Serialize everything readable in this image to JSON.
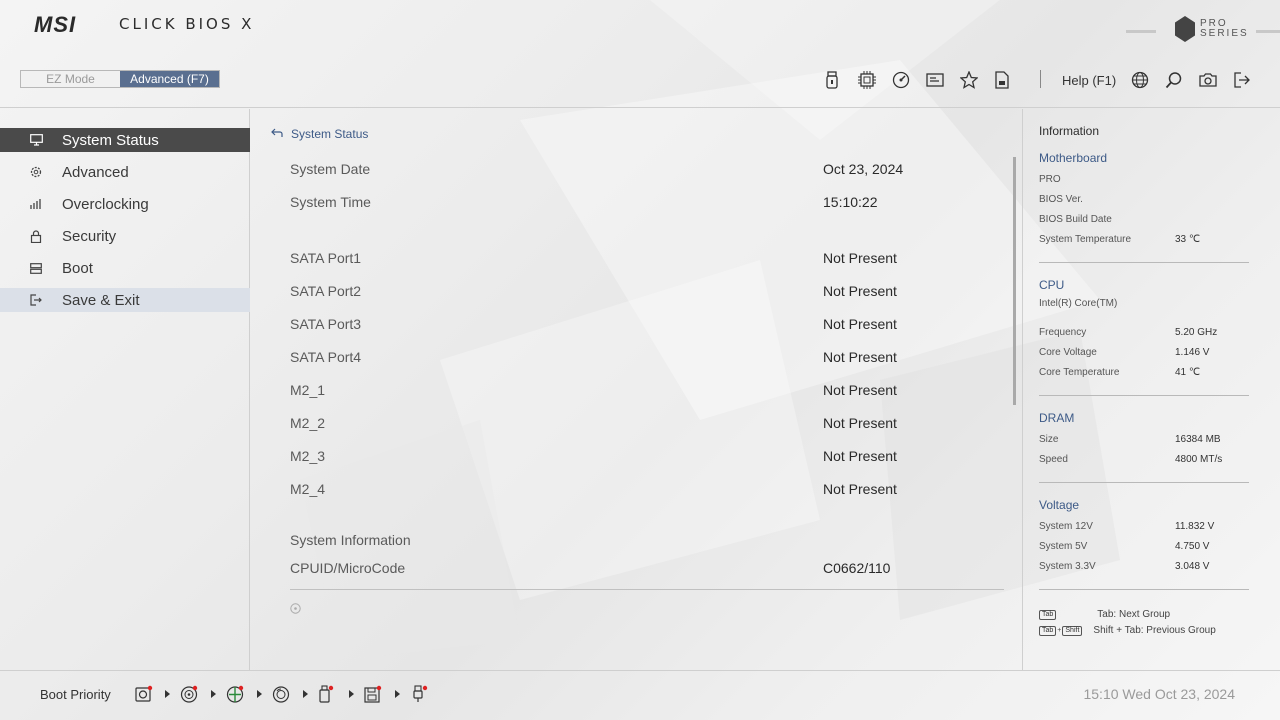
{
  "header": {
    "logo": "MSI",
    "bios_title": "CLICK BIOS X",
    "pro_series_line1": "PRO",
    "pro_series_line2": "SERIES",
    "mode_ez": "EZ Mode",
    "mode_advanced": "Advanced (F7)",
    "help": "Help (F1)",
    "toolbar_icons": [
      "usb-drive-icon",
      "cpu-chip-icon",
      "speedometer-icon",
      "memory-card-icon",
      "star-icon",
      "document-icon"
    ],
    "right_icons": [
      "globe-icon",
      "search-icon",
      "camera-icon",
      "exit-icon"
    ]
  },
  "sidebar": {
    "items": [
      {
        "label": "System Status",
        "icon": "monitor-icon",
        "state": "active"
      },
      {
        "label": "Advanced",
        "icon": "gear-icon",
        "state": "normal"
      },
      {
        "label": "Overclocking",
        "icon": "gauge-icon",
        "state": "normal"
      },
      {
        "label": "Security",
        "icon": "lock-icon",
        "state": "normal"
      },
      {
        "label": "Boot",
        "icon": "drive-icon",
        "state": "normal"
      },
      {
        "label": "Save & Exit",
        "icon": "logout-icon",
        "state": "hover"
      }
    ]
  },
  "main": {
    "breadcrumb": "System Status",
    "rows": [
      {
        "key": "System Date",
        "value": "Oct 23, 2024"
      },
      {
        "key": "System Time",
        "value": "15:10:22"
      },
      {
        "key": "SATA Port1",
        "value": "Not Present"
      },
      {
        "key": "SATA Port2",
        "value": "Not Present"
      },
      {
        "key": "SATA Port3",
        "value": "Not Present"
      },
      {
        "key": "SATA Port4",
        "value": "Not Present"
      },
      {
        "key": "M2_1",
        "value": "Not Present"
      },
      {
        "key": "M2_2",
        "value": "Not Present"
      },
      {
        "key": "M2_3",
        "value": "Not Present"
      },
      {
        "key": "M2_4",
        "value": "Not Present"
      }
    ],
    "system_information": "System Information",
    "cpuid_key": "CPUID/MicroCode",
    "cpuid_value": "C0662/110"
  },
  "info": {
    "title": "Information",
    "motherboard": {
      "heading": "Motherboard",
      "name": "PRO",
      "bios_ver_label": "BIOS Ver.",
      "bios_build_label": "BIOS Build Date",
      "sys_temp_label": "System Temperature",
      "sys_temp_value": "33 ℃"
    },
    "cpu": {
      "heading": "CPU",
      "name": "Intel(R) Core(TM)",
      "freq_label": "Frequency",
      "freq_value": "5.20 GHz",
      "volt_label": "Core Voltage",
      "volt_value": "1.146 V",
      "temp_label": "Core Temperature",
      "temp_value": "41 ℃"
    },
    "dram": {
      "heading": "DRAM",
      "size_label": "Size",
      "size_value": "16384 MB",
      "speed_label": "Speed",
      "speed_value": "4800 MT/s"
    },
    "voltage": {
      "heading": "Voltage",
      "v12_label": "System 12V",
      "v12_value": "11.832 V",
      "v5_label": "System 5V",
      "v5_value": "4.750 V",
      "v33_label": "System 3.3V",
      "v33_value": "3.048 V"
    },
    "hints": {
      "tab_key": "Tab",
      "shift_key": "Shift",
      "plus": "+",
      "next": "Tab: Next Group",
      "prev": "Shift + Tab: Previous Group"
    }
  },
  "footer": {
    "boot_priority": "Boot Priority",
    "devices": [
      "hdd-icon",
      "optical-disc-icon",
      "network-disc-icon",
      "disc-icon",
      "usb-drive-icon",
      "floppy-icon",
      "usb-key-icon"
    ],
    "clock": "15:10  Wed Oct 23, 2024"
  },
  "colors": {
    "accent": "#5a6f90",
    "link": "#3d5a87",
    "active_bg": "#4a4a4a",
    "hover_bg": "#dbe0e8"
  }
}
